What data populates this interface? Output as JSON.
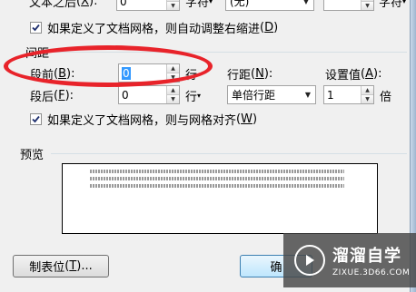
{
  "top_row": {
    "label": "文本之后",
    "label_key": "X",
    "value": "0",
    "unit": "字符",
    "special_combo": "(无)",
    "by_unit": "字符"
  },
  "indent_grid_checkbox": {
    "label": "如果定义了文档网格，则自动调整右缩进",
    "key": "D",
    "checked": true
  },
  "spacing": {
    "section_title": "间距",
    "before_label": "段前",
    "before_key": "B",
    "before_value": "0",
    "before_unit": "行",
    "after_label": "段后",
    "after_key": "F",
    "after_value": "0",
    "after_unit": "行",
    "line_spacing_label": "行距",
    "line_spacing_key": "N",
    "line_spacing_value": "单倍行距",
    "at_label": "设置值",
    "at_key": "A",
    "at_value": "1",
    "at_unit": "倍"
  },
  "snap_grid_checkbox": {
    "label": "如果定义了文档网格，则与网格对齐",
    "key": "W",
    "checked": true
  },
  "preview": {
    "section_title": "预览"
  },
  "buttons": {
    "tabs_label": "制表位",
    "tabs_key": "T",
    "ok_label": "确"
  },
  "watermark": {
    "title": "溜溜自学",
    "subtitle": "ZIXUE.3D66.COM"
  },
  "colors": {
    "annotation": "#e8232a",
    "dialog_bg": "#f0f0f0"
  }
}
